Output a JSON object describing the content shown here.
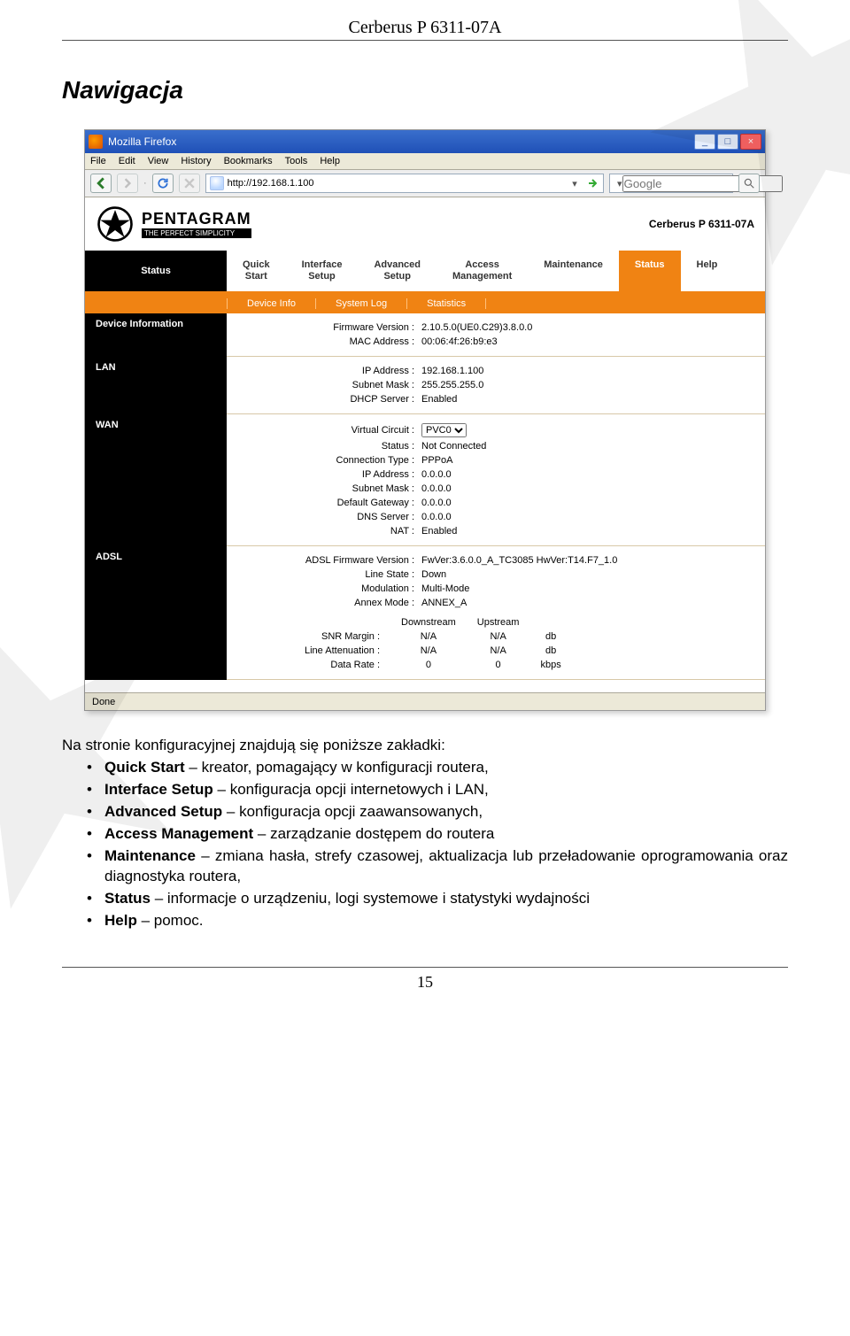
{
  "doc": {
    "header": "Cerberus P 6311-07A",
    "title": "Nawigacja",
    "intro": "Na stronie konfiguracyjnej znajdują się poniższe zakładki:",
    "bullets": [
      {
        "term": "Quick Start",
        "desc": " – kreator, pomagający w konfiguracji routera,"
      },
      {
        "term": "Interface Setup",
        "desc": " – konfiguracja opcji internetowych i LAN,"
      },
      {
        "term": "Advanced Setup",
        "desc": " – konfiguracja opcji zaawansowanych,"
      },
      {
        "term": "Access Management",
        "desc": " – zarządzanie dostępem do routera"
      },
      {
        "term": "Maintenance",
        "desc": " – zmiana hasła, strefy czasowej, aktualizacja lub przeładowanie oprogramowania oraz diagnostyka routera,"
      },
      {
        "term": "Status",
        "desc": " – informacje o urządzeniu, logi systemowe i statystyki wydajności"
      },
      {
        "term": "Help",
        "desc": " – pomoc."
      }
    ],
    "pagenum": "15"
  },
  "browser": {
    "title": "Mozilla Firefox",
    "menus": [
      "File",
      "Edit",
      "View",
      "History",
      "Bookmarks",
      "Tools",
      "Help"
    ],
    "url": "http://192.168.1.100",
    "search_placeholder": "Google",
    "search_prefix": "G",
    "status": "Done"
  },
  "router": {
    "brand_name": "PENTAGRAM",
    "brand_tag": "THE PERFECT SIMPLICITY",
    "model": "Cerberus P 6311-07A",
    "tabs": {
      "status": "Status",
      "items": [
        {
          "l1": "Quick",
          "l2": "Start"
        },
        {
          "l1": "Interface",
          "l2": "Setup"
        },
        {
          "l1": "Advanced",
          "l2": "Setup"
        },
        {
          "l1": "Access",
          "l2": "Management"
        },
        {
          "l1": "Maintenance",
          "l2": ""
        },
        {
          "l1": "Status",
          "l2": "",
          "active": true
        },
        {
          "l1": "Help",
          "l2": ""
        }
      ]
    },
    "subtabs": [
      "Device Info",
      "System Log",
      "Statistics"
    ],
    "device_info": {
      "heading": "Device Information",
      "fw_label": "Firmware Version :",
      "fw": "2.10.5.0(UE0.C29)3.8.0.0",
      "mac_label": "MAC Address :",
      "mac": "00:06:4f:26:b9:e3"
    },
    "lan": {
      "heading": "LAN",
      "ip_label": "IP Address :",
      "ip": "192.168.1.100",
      "mask_label": "Subnet Mask :",
      "mask": "255.255.255.0",
      "dhcp_label": "DHCP Server :",
      "dhcp": "Enabled"
    },
    "wan": {
      "heading": "WAN",
      "vc_label": "Virtual Circuit :",
      "vc": "PVC0",
      "status_label": "Status :",
      "status": "Not Connected",
      "ct_label": "Connection Type :",
      "ct": "PPPoA",
      "ip_label": "IP Address :",
      "ip": "0.0.0.0",
      "mask_label": "Subnet Mask :",
      "mask": "0.0.0.0",
      "gw_label": "Default Gateway :",
      "gw": "0.0.0.0",
      "dns_label": "DNS Server :",
      "dns": "0.0.0.0",
      "nat_label": "NAT :",
      "nat": "Enabled"
    },
    "adsl": {
      "heading": "ADSL",
      "fw_label": "ADSL Firmware Version :",
      "fw": "FwVer:3.6.0.0_A_TC3085 HwVer:T14.F7_1.0",
      "ls_label": "Line State :",
      "ls": "Down",
      "mod_label": "Modulation :",
      "mod": "Multi-Mode",
      "annex_label": "Annex Mode :",
      "annex": "ANNEX_A",
      "cols": [
        "",
        "Downstream",
        "Upstream",
        ""
      ],
      "rows": [
        {
          "k": "SNR Margin :",
          "d": "N/A",
          "u": "N/A",
          "unit": "db"
        },
        {
          "k": "Line Attenuation :",
          "d": "N/A",
          "u": "N/A",
          "unit": "db"
        },
        {
          "k": "Data Rate :",
          "d": "0",
          "u": "0",
          "unit": "kbps"
        }
      ]
    }
  }
}
